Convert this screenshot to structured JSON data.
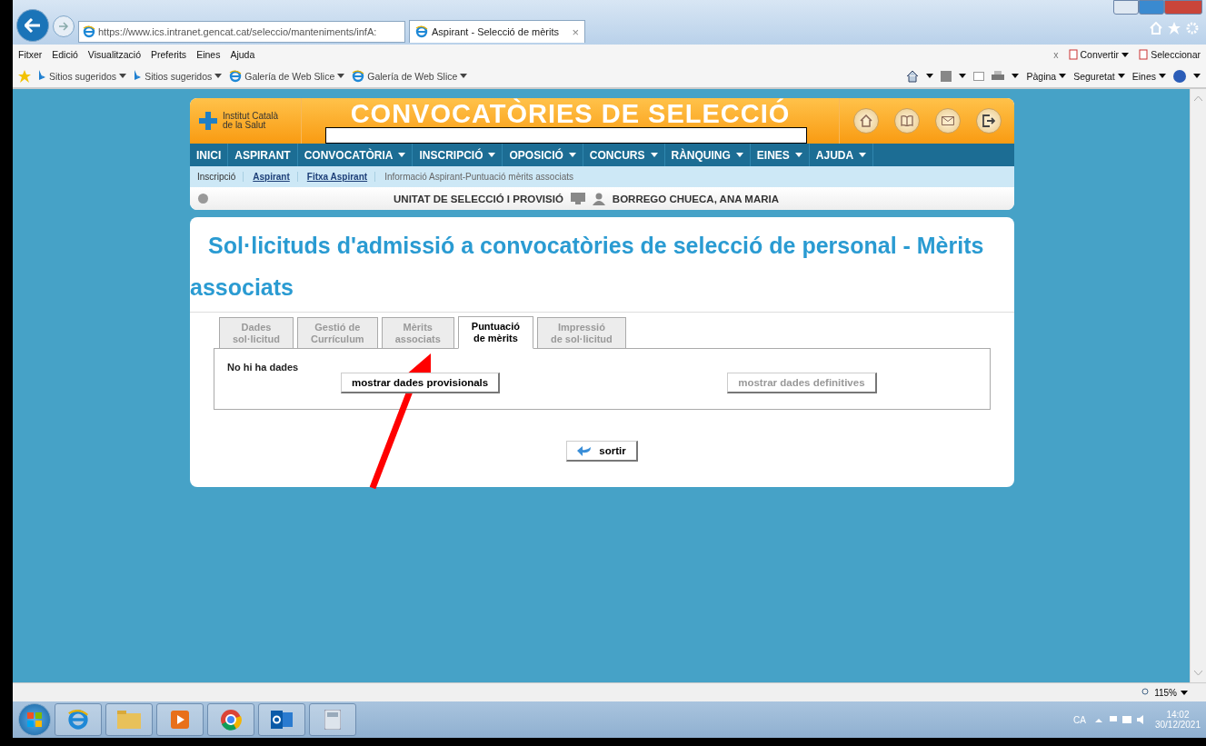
{
  "browser": {
    "address": "https://www.ics.intranet.gencat.cat/seleccio/manteniments/infA:",
    "tab_title": "Aspirant - Selecció de mèrits",
    "tab_close": "×",
    "menu": [
      "Fitxer",
      "Edició",
      "Visualització",
      "Preferits",
      "Eines",
      "Ajuda"
    ],
    "favorites": [
      {
        "label": "Sitios sugeridos",
        "kind": "bing"
      },
      {
        "label": "Sitios sugeridos",
        "kind": "bing"
      },
      {
        "label": "Galería de Web Slice",
        "kind": "slice"
      },
      {
        "label": "Galería de Web Slice",
        "kind": "slice"
      }
    ],
    "close_bar": "x",
    "tools": [
      "Convertir",
      "Seleccionar"
    ],
    "command_bar": [
      "Pàgina",
      "Seguretat",
      "Eines"
    ],
    "zoom": "115%"
  },
  "site": {
    "logo": "Institut Català\nde la Salut",
    "title": "CONVOCATÒRIES DE SELECCIÓ",
    "nav": [
      {
        "label": "INICI",
        "dropdown": false
      },
      {
        "label": "ASPIRANT",
        "dropdown": false
      },
      {
        "label": "CONVOCATÒRIA",
        "dropdown": true
      },
      {
        "label": "INSCRIPCIÓ",
        "dropdown": true
      },
      {
        "label": "OPOSICIÓ",
        "dropdown": true
      },
      {
        "label": "CONCURS",
        "dropdown": true
      },
      {
        "label": "RÀNQUING",
        "dropdown": true
      },
      {
        "label": "EINES",
        "dropdown": true
      },
      {
        "label": "AJUDA",
        "dropdown": true
      }
    ],
    "breadcrumb": [
      {
        "label": "Inscripció",
        "link": false
      },
      {
        "label": "Aspirant",
        "link": true
      },
      {
        "label": "Fitxa Aspirant",
        "link": true
      },
      {
        "label": "Informació Aspirant-Puntuació mèrits associats",
        "link": false
      }
    ],
    "unit": "UNITAT DE SELECCIÓ I PROVISIÓ",
    "user": "BORREGO CHUECA, ANA MARIA"
  },
  "page": {
    "heading": "Sol·licituds d'admissió a convocatòries de selecció de personal - Mèrits associats",
    "tabs": [
      {
        "label": "Dades\nsol·licitud",
        "selected": false
      },
      {
        "label": "Gestió de\nCurrículum",
        "selected": false
      },
      {
        "label": "Mèrits\nassociats",
        "selected": false
      },
      {
        "label": "Puntuació\nde mèrits",
        "selected": true
      },
      {
        "label": "Impressió\nde sol·licitud",
        "selected": false
      }
    ],
    "message": "No hi ha dades",
    "buttons": [
      {
        "label": "mostrar dades provisionals",
        "disabled": false
      },
      {
        "label": "mostrar dades definitives",
        "disabled": true
      }
    ],
    "exit": "sortir"
  },
  "taskbar": {
    "language": "CA",
    "time": "14:02",
    "date": "30/12/2021"
  }
}
